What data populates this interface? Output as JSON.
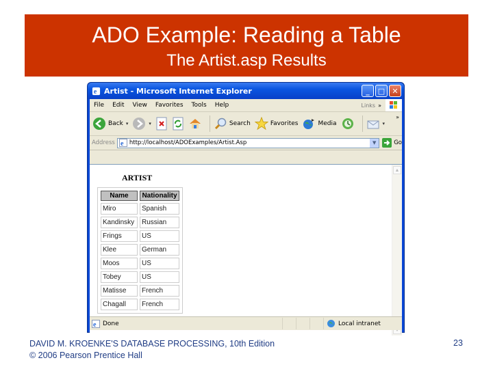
{
  "slide": {
    "title": "ADO Example: Reading a Table",
    "subtitle": "The Artist.asp Results",
    "colors": {
      "title_band": "#cc3300",
      "title_text": "#ffffff",
      "footer_text": "#1f3c84"
    }
  },
  "browser": {
    "window_title": "Artist - Microsoft Internet Explorer",
    "window_buttons": [
      "minimize",
      "maximize",
      "close"
    ],
    "menu": [
      "File",
      "Edit",
      "View",
      "Favorites",
      "Tools",
      "Help"
    ],
    "links_label": "Links",
    "links_chevron": "»",
    "toolbar": {
      "back_label": "Back",
      "search_label": "Search",
      "favorites_label": "Favorites",
      "media_label": "Media",
      "overflow": "»"
    },
    "address": {
      "label": "Address",
      "url": "http://localhost/ADOExamples/Artist.Asp",
      "go_label": "Go"
    },
    "page": {
      "heading": "ARTIST",
      "columns": [
        "Name",
        "Nationality"
      ],
      "rows": [
        [
          "Miro",
          "Spanish"
        ],
        [
          "Kandinsky",
          "Russian"
        ],
        [
          "Frings",
          "US"
        ],
        [
          "Klee",
          "German"
        ],
        [
          "Moos",
          "US"
        ],
        [
          "Tobey",
          "US"
        ],
        [
          "Matisse",
          "French"
        ],
        [
          "Chagall",
          "French"
        ]
      ]
    },
    "status": {
      "text": "Done",
      "zone": "Local intranet"
    }
  },
  "footer": {
    "line1": "DAVID M. KROENKE'S DATABASE PROCESSING, 10th Edition",
    "line2": "© 2006 Pearson Prentice Hall",
    "page_number": "23"
  }
}
